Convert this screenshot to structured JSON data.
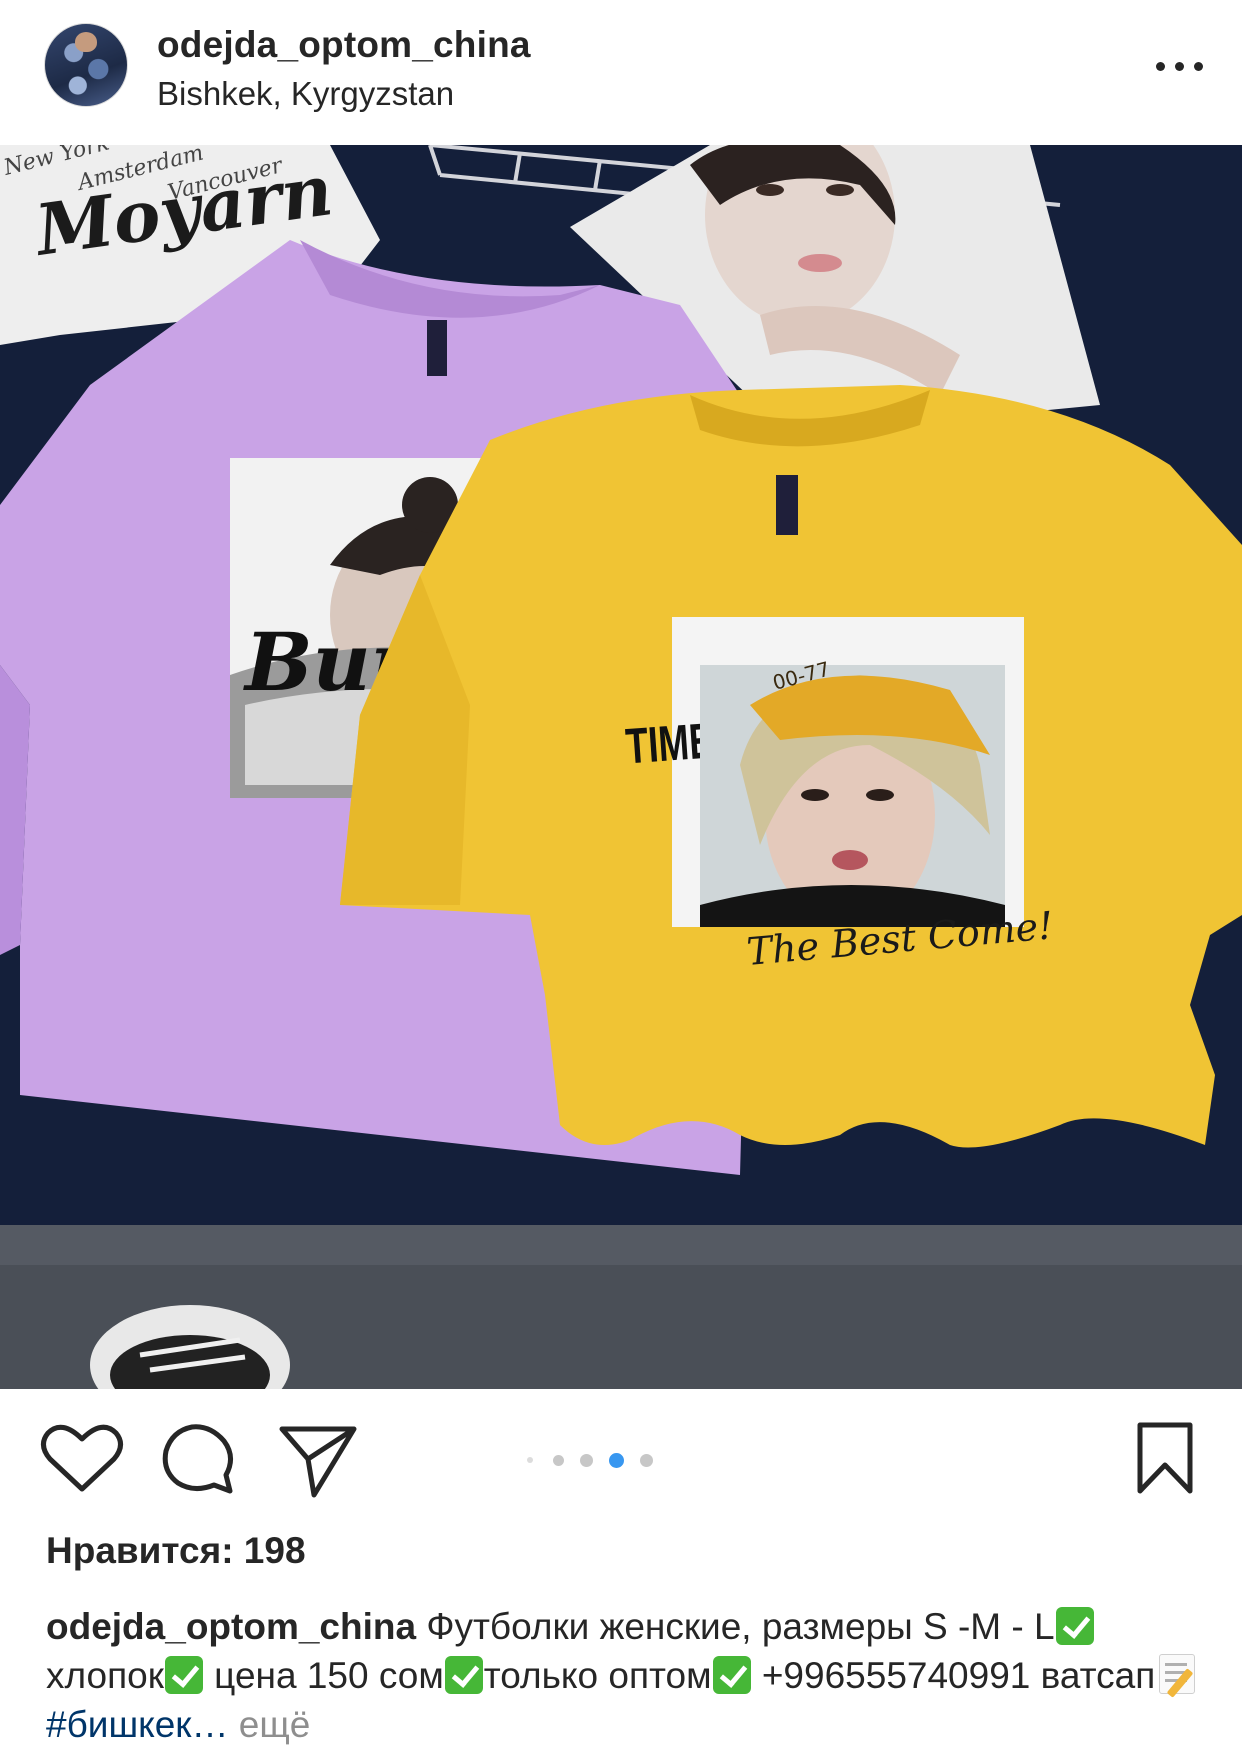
{
  "post": {
    "username": "odejda_optom_china",
    "location": "Bishkek, Kyrgyzstan",
    "more_icon": "more-horizontal-icon"
  },
  "photo": {
    "print_headline": "TIME OF CHANGE",
    "print_tagline": "The Best Come!",
    "cap_text": "00-77",
    "poster_text_1": "Moyarn",
    "poster_text_2": "New York",
    "poster_text_3": "Amsterdam",
    "poster_text_4": "Vancouver",
    "purple_print_text": "Buu",
    "colors": {
      "purple_shirt": "#c9a3e6",
      "yellow_shirt": "#f0c434",
      "background": "#141f3a"
    }
  },
  "carousel": {
    "count": 5,
    "active_index": 3
  },
  "actions": {
    "like_icon": "heart-icon",
    "comment_icon": "comment-icon",
    "share_icon": "send-icon",
    "save_icon": "bookmark-icon"
  },
  "likes_text": "Нравится: 198",
  "caption": {
    "author": "odejda_optom_china",
    "seg1": "Футболки женские, размеры S -M - L",
    "seg2": " хлопок",
    "seg3": " цена 150 сом",
    "seg4": "только оптом",
    "seg5": "+996555740991 ватсап",
    "hashtag": "#бишкек…",
    "more_label": "ещё"
  }
}
